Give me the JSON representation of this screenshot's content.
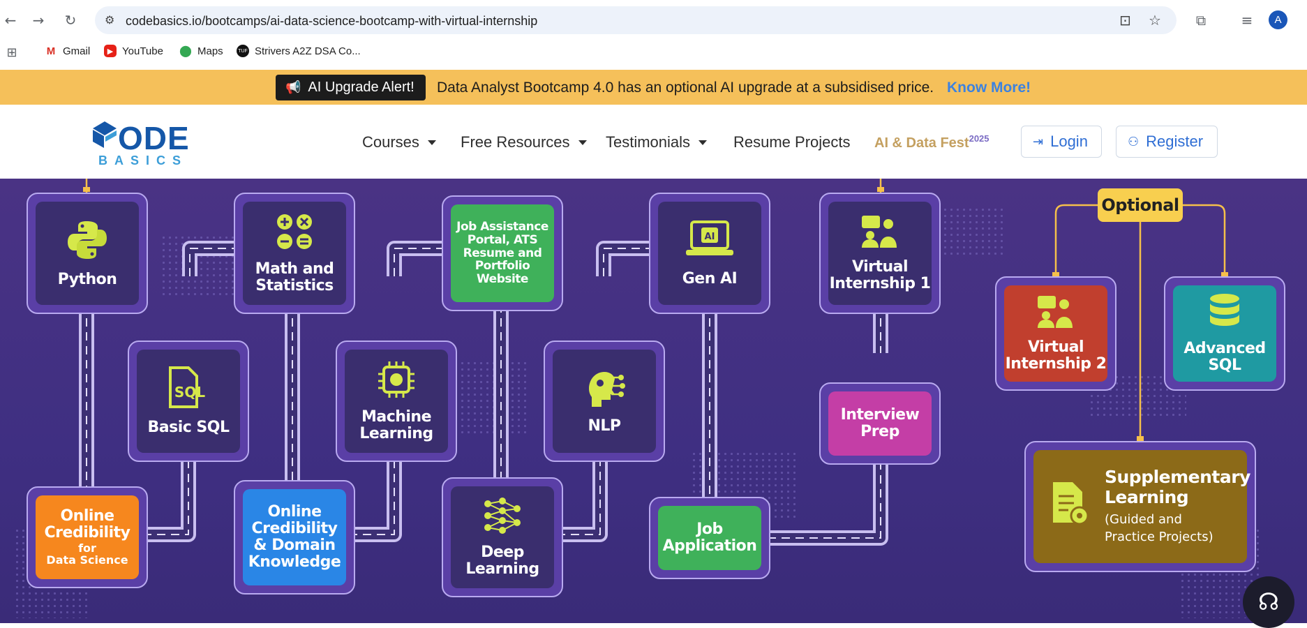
{
  "browser": {
    "url": "codebasics.io/bootcamps/ai-data-science-bootcamp-with-virtual-internship",
    "profile_initial": "A",
    "bookmarks": [
      {
        "label": "Gmail",
        "icon": "gmail-icon"
      },
      {
        "label": "YouTube",
        "icon": "youtube-icon"
      },
      {
        "label": "Maps",
        "icon": "maps-icon"
      },
      {
        "label": "Strivers A2Z DSA Co...",
        "icon": "tuf-icon"
      }
    ]
  },
  "banner": {
    "alert": "AI Upgrade Alert!",
    "message": "Data Analyst Bootcamp 4.0 has an optional AI upgrade at a subsidised price.",
    "link": "Know More!",
    "bg_color": "#f5c05a",
    "link_color": "#3c82e0"
  },
  "header": {
    "logo_top": "ODE",
    "logo_bottom": "BASICS",
    "menu": [
      "Courses",
      "Free Resources",
      "Testimonials",
      "Resume Projects"
    ],
    "fest": "AI & Data Fest",
    "fest_year": "2025",
    "login": "Login",
    "register": "Register"
  },
  "roadmap": {
    "optional_label": "Optional",
    "nodes": {
      "python": {
        "label": "Python",
        "color": "#3a2e6e"
      },
      "math": {
        "label": "Math and Statistics",
        "color": "#3a2e6e"
      },
      "job_assist": {
        "label": "Job Assistance Portal, ATS Resume and Portfolio Website",
        "color": "#3fb15a"
      },
      "gen_ai": {
        "label": "Gen AI",
        "color": "#3a2e6e"
      },
      "vi1": {
        "label": "Virtual Internship 1",
        "color": "#3a2e6e"
      },
      "basic_sql": {
        "label": "Basic SQL",
        "color": "#3a2e6e"
      },
      "ml": {
        "label": "Machine Learning",
        "color": "#3a2e6e"
      },
      "nlp": {
        "label": "NLP",
        "color": "#3a2e6e"
      },
      "interview": {
        "label": "Interview Prep",
        "color": "#c43ea6"
      },
      "cred_ds": {
        "label": "Online Credibility",
        "sub1": "for",
        "sub2": "Data Science",
        "color": "#f6871e"
      },
      "cred_dk": {
        "label": "Online Credibility & Domain Knowledge",
        "color": "#2a86e6"
      },
      "dl": {
        "label": "Deep Learning",
        "color": "#3a2e6e"
      },
      "job_app": {
        "label": "Job Application",
        "color": "#3fb15a"
      },
      "vi2": {
        "label": "Virtual Internship 2",
        "color": "#c13f2e"
      },
      "adv_sql": {
        "label": "Advanced SQL",
        "color": "#1f9aa2"
      },
      "supp": {
        "label": "Supplementary Learning",
        "sub": "(Guided and Practice Projects)",
        "color": "#8c6a18"
      }
    }
  }
}
